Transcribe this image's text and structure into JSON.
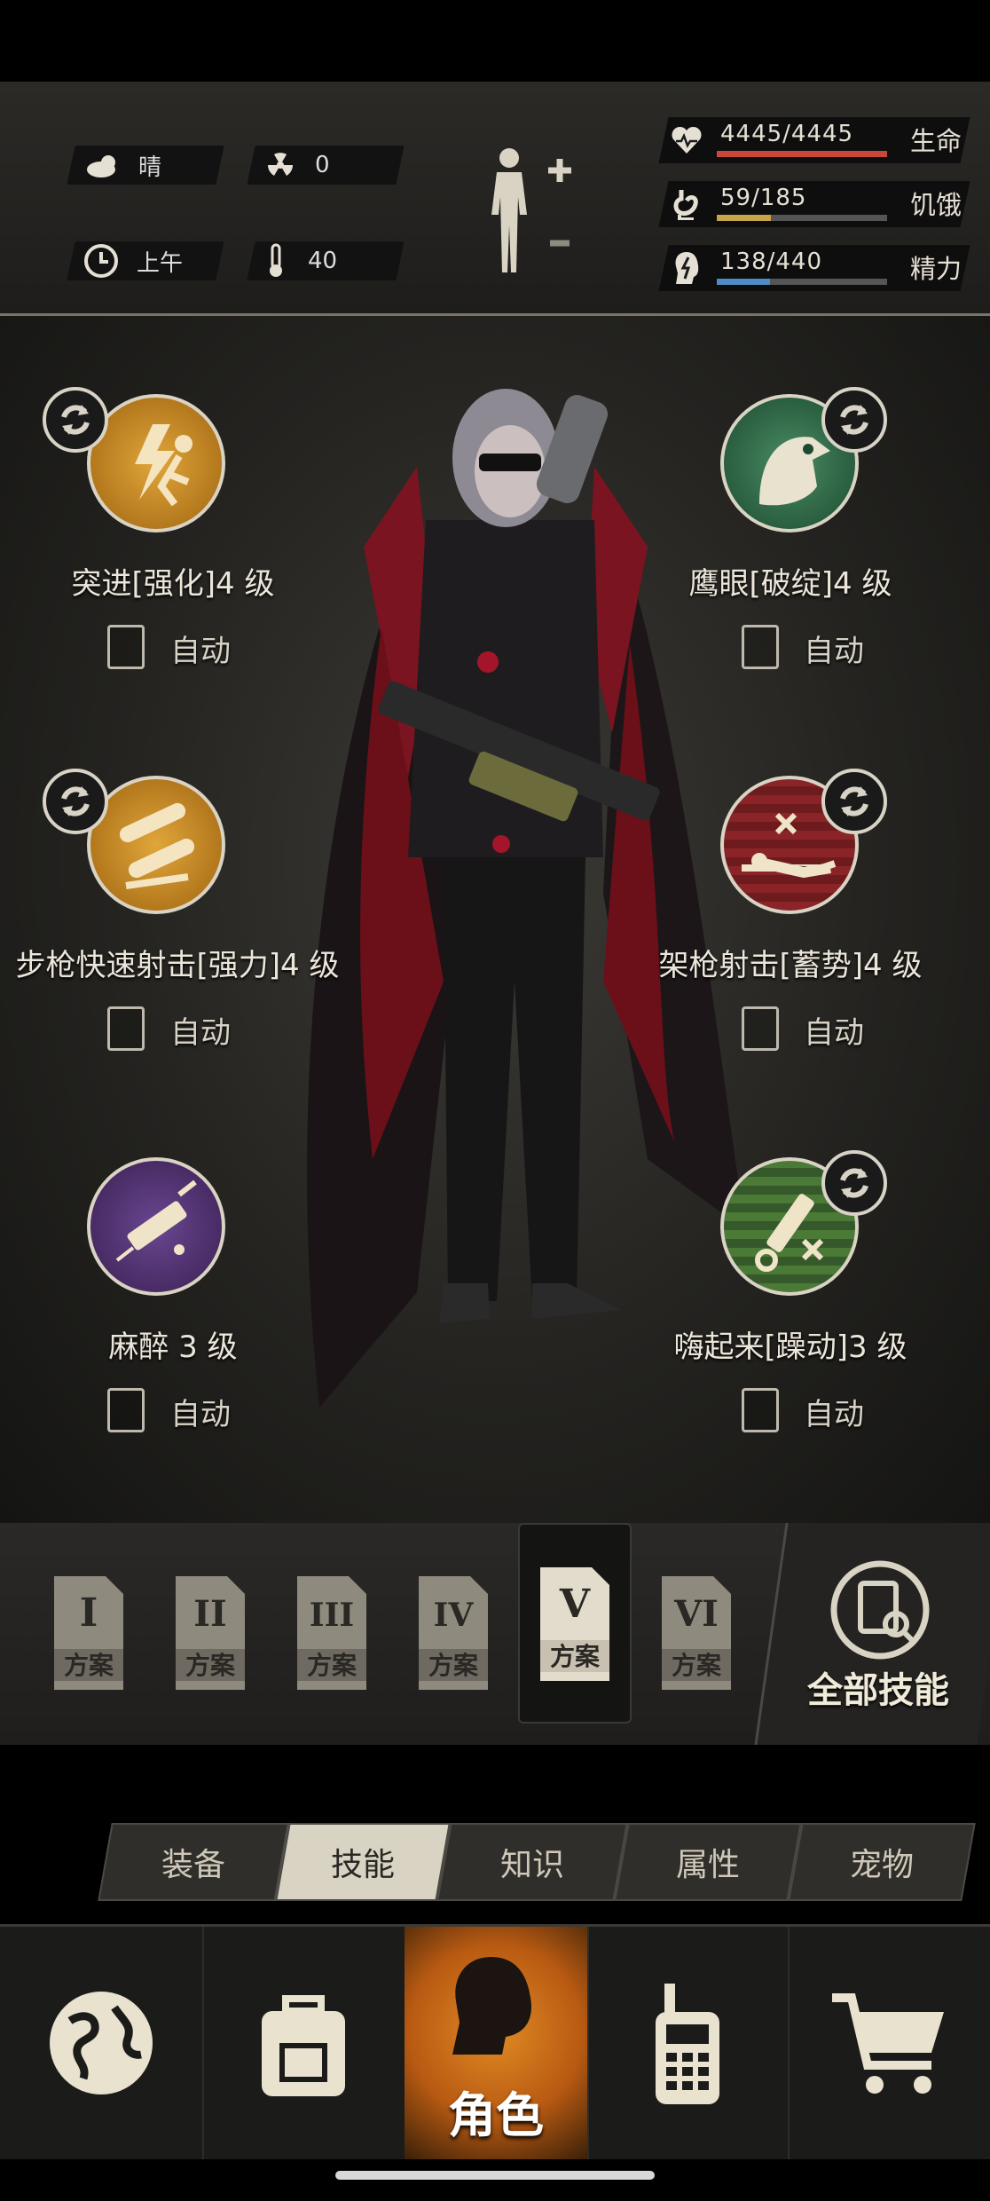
{
  "hud": {
    "weather": "晴",
    "radiation": "0",
    "time_of_day": "上午",
    "temperature": "40",
    "stats": [
      {
        "value": "4445/4445",
        "label": "生命",
        "fraction": 1.0,
        "color": "#c9463a"
      },
      {
        "value": "59/185",
        "label": "饥饿",
        "fraction": 0.32,
        "color": "#c9a34a"
      },
      {
        "value": "138/440",
        "label": "精力",
        "fraction": 0.31,
        "color": "#4d8cc4"
      }
    ]
  },
  "skills": [
    {
      "name": "突进[强化]4 级",
      "auto_label": "自动",
      "icon": "sprint-runner-icon",
      "color": "#c98a1f",
      "swappable": true
    },
    {
      "name": "鹰眼[破绽]4 级",
      "auto_label": "自动",
      "icon": "eagle-eye-icon",
      "color": "#2f6a49",
      "swappable": true
    },
    {
      "name": "步枪快速射击[强力]4 级",
      "auto_label": "自动",
      "icon": "rifle-bullets-icon",
      "color": "#c98a1f",
      "swappable": true
    },
    {
      "name": "架枪射击[蓄势]4 级",
      "auto_label": "自动",
      "icon": "prone-sniper-icon",
      "color": "#8a2428",
      "swappable": true
    },
    {
      "name": "麻醉 3 级",
      "auto_label": "自动",
      "icon": "syringe-icon",
      "color": "#4b2c66",
      "swappable": false
    },
    {
      "name": "嗨起来[躁动]3 级",
      "auto_label": "自动",
      "icon": "stim-syringe-icon",
      "color": "#3d6a2c",
      "swappable": true
    }
  ],
  "plans": [
    {
      "numeral": "I",
      "label": "方案",
      "active": false
    },
    {
      "numeral": "II",
      "label": "方案",
      "active": false
    },
    {
      "numeral": "III",
      "label": "方案",
      "active": false
    },
    {
      "numeral": "IV",
      "label": "方案",
      "active": false
    },
    {
      "numeral": "V",
      "label": "方案",
      "active": true
    },
    {
      "numeral": "VI",
      "label": "方案",
      "active": false
    }
  ],
  "all_skills_label": "全部技能",
  "tabs": [
    {
      "label": "装备",
      "active": false
    },
    {
      "label": "技能",
      "active": true
    },
    {
      "label": "知识",
      "active": false
    },
    {
      "label": "属性",
      "active": false
    },
    {
      "label": "宠物",
      "active": false
    }
  ],
  "nav": [
    {
      "icon": "globe-icon"
    },
    {
      "icon": "backpack-icon"
    },
    {
      "icon": "character-head-icon",
      "label": "角色",
      "active": true
    },
    {
      "icon": "radio-icon"
    },
    {
      "icon": "cart-icon"
    }
  ]
}
